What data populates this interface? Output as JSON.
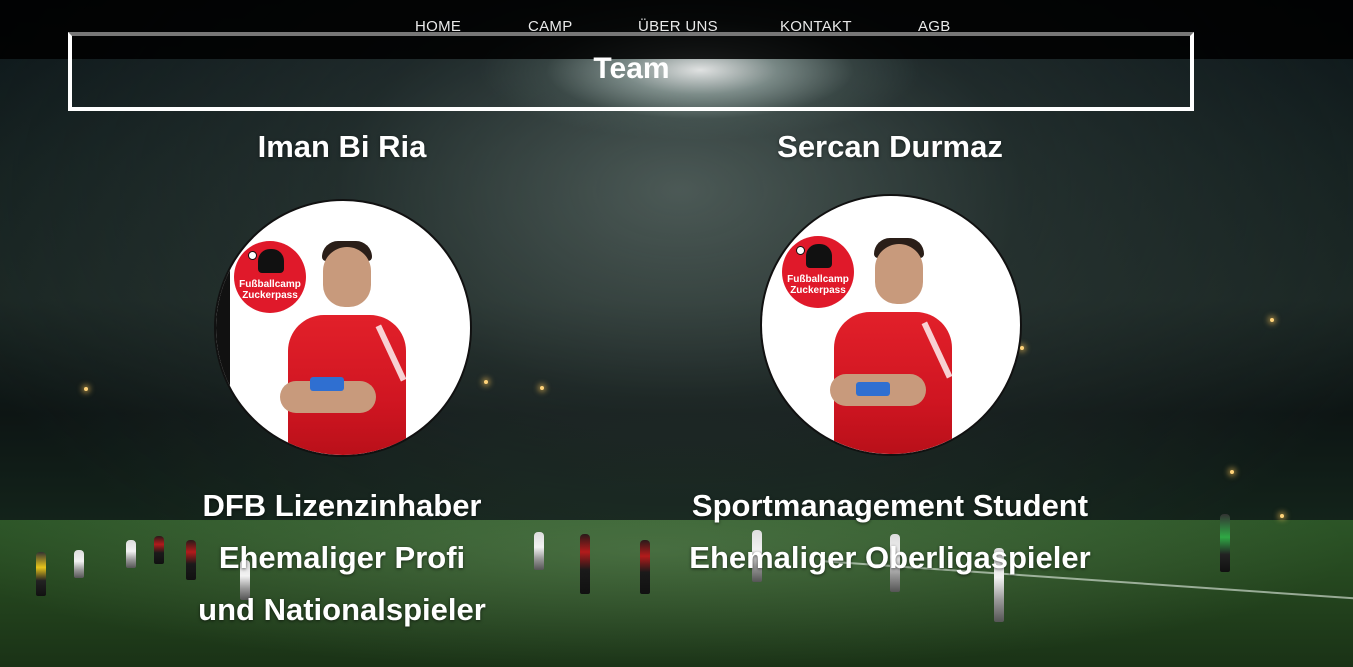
{
  "nav": {
    "items": [
      {
        "label": "HOME"
      },
      {
        "label": "CAMP"
      },
      {
        "label": "ÜBER UNS"
      },
      {
        "label": "KONTAKT"
      },
      {
        "label": "AGB"
      }
    ]
  },
  "team": {
    "title": "Team",
    "members": [
      {
        "name": "Iman Bi Ria",
        "roles": [
          "DFB Lizenzinhaber",
          "Ehemaliger Profi",
          "und Nationalspieler"
        ],
        "logo_text": [
          "Fußballcamp",
          "Zuckerpass"
        ]
      },
      {
        "name": "Sercan Durmaz",
        "roles": [
          "Sportmanagement Student",
          "Ehemaliger Oberligaspieler"
        ],
        "logo_text": [
          "Fußballcamp",
          "Zuckerpass"
        ]
      }
    ]
  },
  "colors": {
    "nav_bg": "#000000",
    "jersey_red": "#e0192a",
    "text": "#ffffff"
  }
}
